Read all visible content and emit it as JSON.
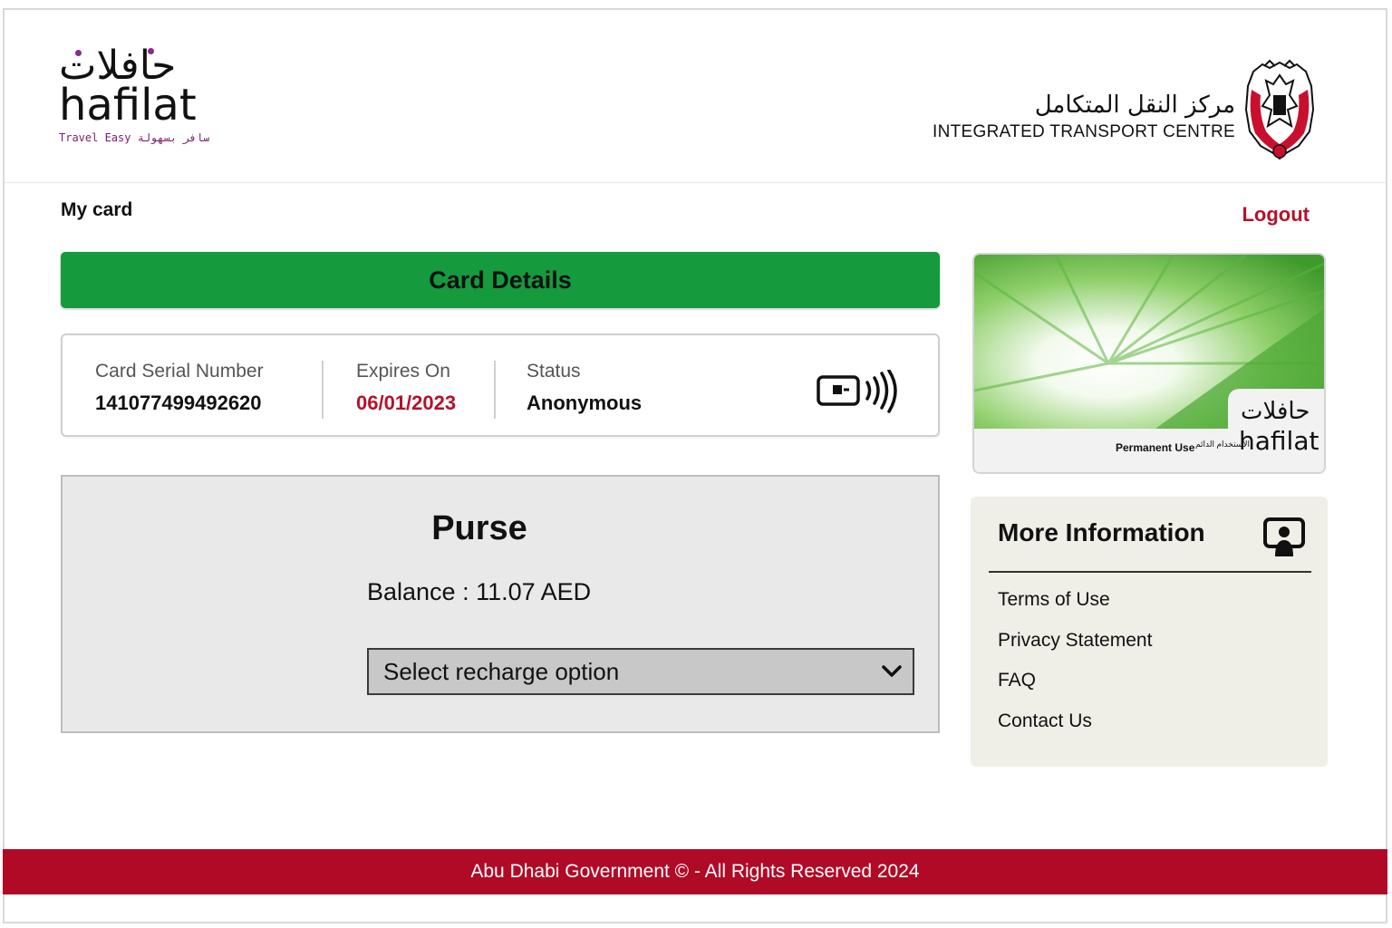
{
  "header": {
    "brand_arabic": "حافلات",
    "brand_latin": "hafilat",
    "brand_tagline": "Travel Easy سافر بسهولة",
    "org_arabic": "مركز النقل المتكامل",
    "org_english": "INTEGRATED TRANSPORT CENTRE"
  },
  "nav": {
    "page_label": "My card",
    "logout_label": "Logout"
  },
  "card_details": {
    "title": "Card Details",
    "serial_label": "Card Serial Number",
    "serial_value": "141077499492620",
    "expires_label": "Expires On",
    "expires_value": "06/01/2023",
    "status_label": "Status",
    "status_value": "Anonymous"
  },
  "purse": {
    "title": "Purse",
    "balance_text": "Balance : 11.07 AED",
    "recharge_placeholder": "Select recharge option"
  },
  "card_image": {
    "usage_en": "Permanent Use",
    "usage_ar": "الاستخدام الدائم",
    "brand_arabic": "حافلات",
    "brand_latin": "hafilat"
  },
  "more_info": {
    "title": "More Information",
    "links": [
      "Terms of Use",
      "Privacy Statement",
      "FAQ",
      "Contact Us"
    ]
  },
  "footer": {
    "text": "Abu Dhabi Government © - All Rights Reserved 2024"
  },
  "colors": {
    "accent_green": "#159a3e",
    "brand_red": "#b10a26",
    "expiry_red": "#b5122a",
    "brand_purple": "#7a1e6b"
  }
}
